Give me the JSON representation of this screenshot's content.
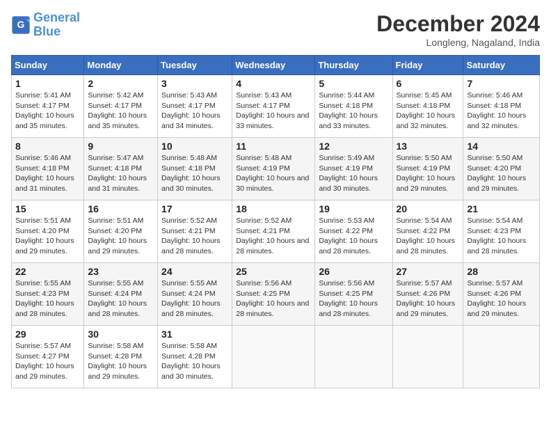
{
  "logo": {
    "line1": "General",
    "line2": "Blue"
  },
  "title": "December 2024",
  "location": "Longleng, Nagaland, India",
  "days_header": [
    "Sunday",
    "Monday",
    "Tuesday",
    "Wednesday",
    "Thursday",
    "Friday",
    "Saturday"
  ],
  "weeks": [
    [
      {
        "day": "1",
        "sunrise": "5:41 AM",
        "sunset": "4:17 PM",
        "daylight": "10 hours and 35 minutes."
      },
      {
        "day": "2",
        "sunrise": "5:42 AM",
        "sunset": "4:17 PM",
        "daylight": "10 hours and 35 minutes."
      },
      {
        "day": "3",
        "sunrise": "5:43 AM",
        "sunset": "4:17 PM",
        "daylight": "10 hours and 34 minutes."
      },
      {
        "day": "4",
        "sunrise": "5:43 AM",
        "sunset": "4:17 PM",
        "daylight": "10 hours and 33 minutes."
      },
      {
        "day": "5",
        "sunrise": "5:44 AM",
        "sunset": "4:18 PM",
        "daylight": "10 hours and 33 minutes."
      },
      {
        "day": "6",
        "sunrise": "5:45 AM",
        "sunset": "4:18 PM",
        "daylight": "10 hours and 32 minutes."
      },
      {
        "day": "7",
        "sunrise": "5:46 AM",
        "sunset": "4:18 PM",
        "daylight": "10 hours and 32 minutes."
      }
    ],
    [
      {
        "day": "8",
        "sunrise": "5:46 AM",
        "sunset": "4:18 PM",
        "daylight": "10 hours and 31 minutes."
      },
      {
        "day": "9",
        "sunrise": "5:47 AM",
        "sunset": "4:18 PM",
        "daylight": "10 hours and 31 minutes."
      },
      {
        "day": "10",
        "sunrise": "5:48 AM",
        "sunset": "4:18 PM",
        "daylight": "10 hours and 30 minutes."
      },
      {
        "day": "11",
        "sunrise": "5:48 AM",
        "sunset": "4:19 PM",
        "daylight": "10 hours and 30 minutes."
      },
      {
        "day": "12",
        "sunrise": "5:49 AM",
        "sunset": "4:19 PM",
        "daylight": "10 hours and 30 minutes."
      },
      {
        "day": "13",
        "sunrise": "5:50 AM",
        "sunset": "4:19 PM",
        "daylight": "10 hours and 29 minutes."
      },
      {
        "day": "14",
        "sunrise": "5:50 AM",
        "sunset": "4:20 PM",
        "daylight": "10 hours and 29 minutes."
      }
    ],
    [
      {
        "day": "15",
        "sunrise": "5:51 AM",
        "sunset": "4:20 PM",
        "daylight": "10 hours and 29 minutes."
      },
      {
        "day": "16",
        "sunrise": "5:51 AM",
        "sunset": "4:20 PM",
        "daylight": "10 hours and 29 minutes."
      },
      {
        "day": "17",
        "sunrise": "5:52 AM",
        "sunset": "4:21 PM",
        "daylight": "10 hours and 28 minutes."
      },
      {
        "day": "18",
        "sunrise": "5:52 AM",
        "sunset": "4:21 PM",
        "daylight": "10 hours and 28 minutes."
      },
      {
        "day": "19",
        "sunrise": "5:53 AM",
        "sunset": "4:22 PM",
        "daylight": "10 hours and 28 minutes."
      },
      {
        "day": "20",
        "sunrise": "5:54 AM",
        "sunset": "4:22 PM",
        "daylight": "10 hours and 28 minutes."
      },
      {
        "day": "21",
        "sunrise": "5:54 AM",
        "sunset": "4:23 PM",
        "daylight": "10 hours and 28 minutes."
      }
    ],
    [
      {
        "day": "22",
        "sunrise": "5:55 AM",
        "sunset": "4:23 PM",
        "daylight": "10 hours and 28 minutes."
      },
      {
        "day": "23",
        "sunrise": "5:55 AM",
        "sunset": "4:24 PM",
        "daylight": "10 hours and 28 minutes."
      },
      {
        "day": "24",
        "sunrise": "5:55 AM",
        "sunset": "4:24 PM",
        "daylight": "10 hours and 28 minutes."
      },
      {
        "day": "25",
        "sunrise": "5:56 AM",
        "sunset": "4:25 PM",
        "daylight": "10 hours and 28 minutes."
      },
      {
        "day": "26",
        "sunrise": "5:56 AM",
        "sunset": "4:25 PM",
        "daylight": "10 hours and 28 minutes."
      },
      {
        "day": "27",
        "sunrise": "5:57 AM",
        "sunset": "4:26 PM",
        "daylight": "10 hours and 29 minutes."
      },
      {
        "day": "28",
        "sunrise": "5:57 AM",
        "sunset": "4:26 PM",
        "daylight": "10 hours and 29 minutes."
      }
    ],
    [
      {
        "day": "29",
        "sunrise": "5:57 AM",
        "sunset": "4:27 PM",
        "daylight": "10 hours and 29 minutes."
      },
      {
        "day": "30",
        "sunrise": "5:58 AM",
        "sunset": "4:28 PM",
        "daylight": "10 hours and 29 minutes."
      },
      {
        "day": "31",
        "sunrise": "5:58 AM",
        "sunset": "4:28 PM",
        "daylight": "10 hours and 30 minutes."
      },
      null,
      null,
      null,
      null
    ]
  ]
}
